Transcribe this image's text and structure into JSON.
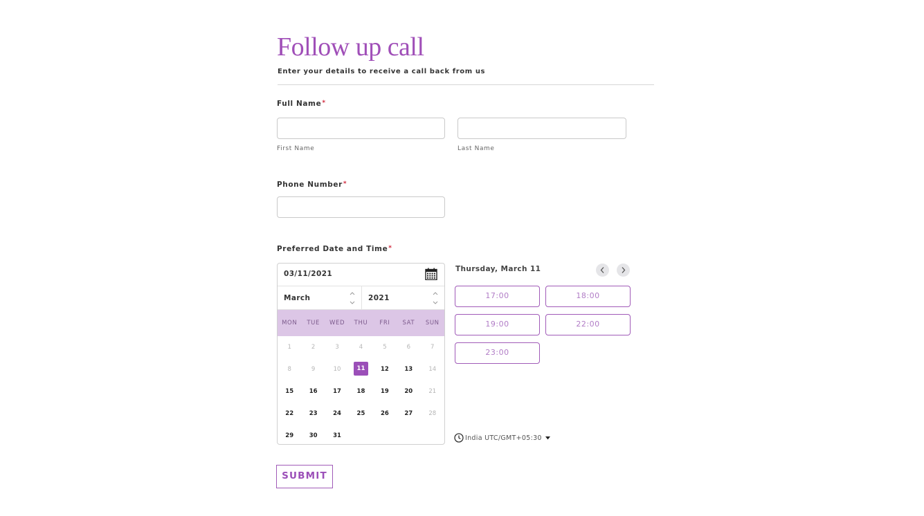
{
  "form": {
    "title": "Follow up call",
    "subtitle": "Enter your details to receive a call back from us",
    "required_mark": "*",
    "full_name": {
      "label": "Full Name",
      "first": {
        "value": "",
        "placeholder": "",
        "sublabel": "First Name"
      },
      "last": {
        "value": "",
        "placeholder": "",
        "sublabel": "Last Name"
      }
    },
    "phone": {
      "label": "Phone Number",
      "value": "",
      "placeholder": ""
    },
    "datetime": {
      "label": "Preferred Date and Time",
      "date_value": "03/11/2021",
      "calendar_icon": "calendar-icon",
      "month_select": "March",
      "year_select": "2021",
      "weekdays": [
        "MON",
        "TUE",
        "WED",
        "THU",
        "FRI",
        "SAT",
        "SUN"
      ],
      "weeks": [
        [
          {
            "d": "1",
            "s": "disabled"
          },
          {
            "d": "2",
            "s": "disabled"
          },
          {
            "d": "3",
            "s": "disabled"
          },
          {
            "d": "4",
            "s": "disabled"
          },
          {
            "d": "5",
            "s": "disabled"
          },
          {
            "d": "6",
            "s": "disabled"
          },
          {
            "d": "7",
            "s": "disabled"
          }
        ],
        [
          {
            "d": "8",
            "s": "disabled"
          },
          {
            "d": "9",
            "s": "disabled"
          },
          {
            "d": "10",
            "s": "disabled"
          },
          {
            "d": "11",
            "s": "selected"
          },
          {
            "d": "12",
            "s": "enabled"
          },
          {
            "d": "13",
            "s": "enabled"
          },
          {
            "d": "14",
            "s": "disabled"
          }
        ],
        [
          {
            "d": "15",
            "s": "enabled"
          },
          {
            "d": "16",
            "s": "enabled"
          },
          {
            "d": "17",
            "s": "enabled"
          },
          {
            "d": "18",
            "s": "enabled"
          },
          {
            "d": "19",
            "s": "enabled"
          },
          {
            "d": "20",
            "s": "enabled"
          },
          {
            "d": "21",
            "s": "disabled"
          }
        ],
        [
          {
            "d": "22",
            "s": "enabled"
          },
          {
            "d": "23",
            "s": "enabled"
          },
          {
            "d": "24",
            "s": "enabled"
          },
          {
            "d": "25",
            "s": "enabled"
          },
          {
            "d": "26",
            "s": "enabled"
          },
          {
            "d": "27",
            "s": "enabled"
          },
          {
            "d": "28",
            "s": "disabled"
          }
        ],
        [
          {
            "d": "29",
            "s": "enabled"
          },
          {
            "d": "30",
            "s": "enabled"
          },
          {
            "d": "31",
            "s": "enabled"
          },
          {
            "d": "",
            "s": "empty"
          },
          {
            "d": "",
            "s": "empty"
          },
          {
            "d": "",
            "s": "empty"
          },
          {
            "d": "",
            "s": "empty"
          }
        ]
      ],
      "slots_heading": "Thursday, March 11",
      "prev_icon": "chevron-left-icon",
      "next_icon": "chevron-right-icon",
      "time_slots": [
        "17:00",
        "18:00",
        "19:00",
        "22:00",
        "23:00"
      ],
      "timezone": "India UTC/GMT+05:30",
      "timezone_icon": "clock-icon"
    },
    "submit_label": "SUBMIT"
  },
  "colors": {
    "accent": "#9b4fb8",
    "weekday_bar": "#dcc6e6",
    "required": "#d0263a"
  }
}
